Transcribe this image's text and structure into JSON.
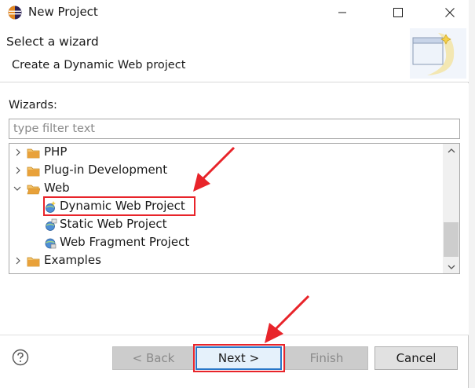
{
  "window": {
    "title": "New Project",
    "app_icon": "eclipse-icon",
    "controls": [
      "minimize-icon",
      "maximize-icon",
      "close-icon"
    ]
  },
  "banner": {
    "title": "Select a wizard",
    "description": "Create a Dynamic Web project",
    "art_icon": "wizard-banner-icon"
  },
  "wizards": {
    "label": "Wizards:",
    "filter_placeholder": "type filter text",
    "filter_value": "",
    "tree": [
      {
        "label": "PHP",
        "type": "folder",
        "expanded": false,
        "level": 0
      },
      {
        "label": "Plug-in Development",
        "type": "folder",
        "expanded": false,
        "level": 0
      },
      {
        "label": "Web",
        "type": "folder",
        "expanded": true,
        "level": 0
      },
      {
        "label": "Dynamic Web Project",
        "type": "project",
        "level": 1,
        "selected": true
      },
      {
        "label": "Static Web Project",
        "type": "project",
        "level": 1
      },
      {
        "label": "Web Fragment Project",
        "type": "project",
        "level": 1
      },
      {
        "label": "Examples",
        "type": "folder",
        "expanded": false,
        "level": 0
      }
    ]
  },
  "buttons": {
    "help": "help-icon",
    "back": "< Back",
    "next": "Next >",
    "finish": "Finish",
    "cancel": "Cancel"
  },
  "colors": {
    "annotation_red": "#e8242a",
    "focus_blue": "#2877c8",
    "folder_orange": "#e8a13a"
  },
  "background_fragment": "i"
}
